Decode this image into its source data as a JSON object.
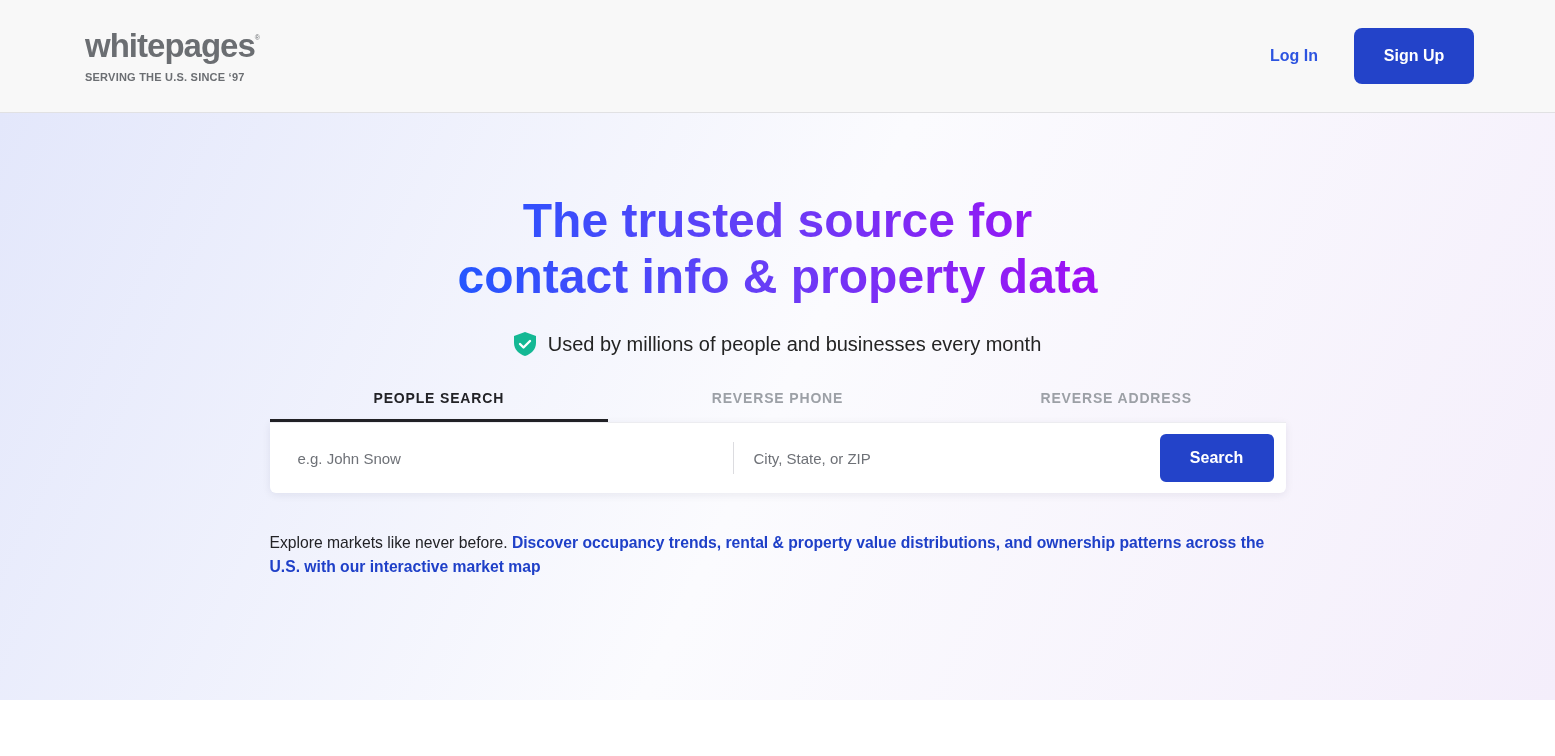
{
  "header": {
    "logo": {
      "wordmark": "whitepages$^{®}$",
      "tagline": "SERVING THE U.S. SINCE ‘97"
    },
    "login_link": "Log In",
    "signup_button": "Sign Up"
  },
  "hero": {
    "headline": "The trusted source for contact info & property data",
    "trust_line": "Used by millions of people and businesses every month"
  },
  "tabs": [
    {
      "label": "PEOPLE SEARCH",
      "selected": true
    },
    {
      "label": "REVERSE PHONE",
      "selected": false
    },
    {
      "label": "REVERSE ADDRESS",
      "selected": false
    }
  ],
  "search_form": {
    "fields": [
      {
        "placeholder": "e.g. John Snow"
      },
      {
        "placeholder": "City, State, or ZIP"
      }
    ],
    "button": "Search"
  },
  "promo_text": "Explore markets like never before. **Discover occupancy trends, rental & property value distributions, and ownership patterns across the U.S. with our interactive market map**"
}
